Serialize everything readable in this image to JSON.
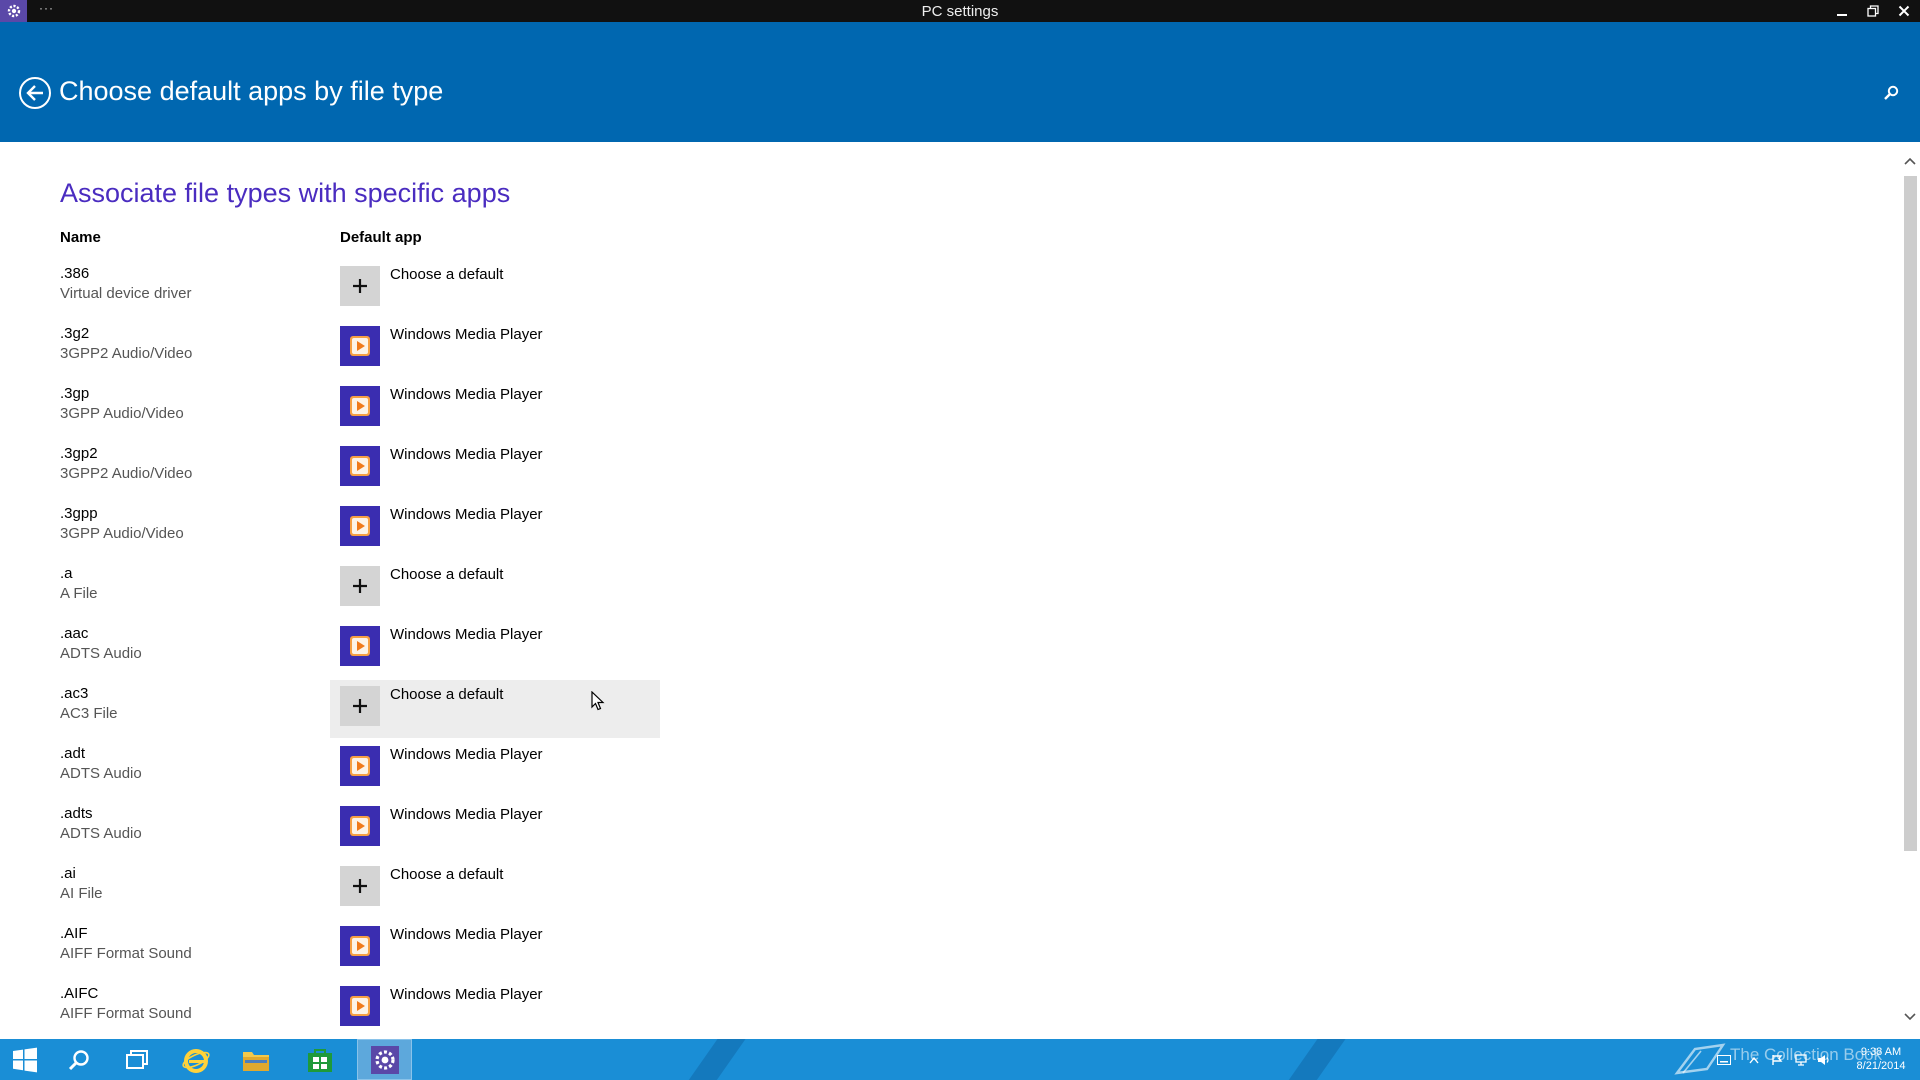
{
  "window": {
    "title": "PC settings",
    "menu_dots": "···"
  },
  "header": {
    "title": "Choose default apps by file type"
  },
  "content": {
    "section_title": "Associate file types with specific apps",
    "col_name": "Name",
    "col_app": "Default app",
    "rows": [
      {
        "ext": ".386",
        "desc": "Virtual device driver",
        "app": "Choose a default",
        "icon": "plus-icon"
      },
      {
        "ext": ".3g2",
        "desc": "3GPP2 Audio/Video",
        "app": "Windows Media Player",
        "icon": "windows-media-player-icon"
      },
      {
        "ext": ".3gp",
        "desc": "3GPP Audio/Video",
        "app": "Windows Media Player",
        "icon": "windows-media-player-icon"
      },
      {
        "ext": ".3gp2",
        "desc": "3GPP2 Audio/Video",
        "app": "Windows Media Player",
        "icon": "windows-media-player-icon"
      },
      {
        "ext": ".3gpp",
        "desc": "3GPP Audio/Video",
        "app": "Windows Media Player",
        "icon": "windows-media-player-icon"
      },
      {
        "ext": ".a",
        "desc": "A File",
        "app": "Choose a default",
        "icon": "plus-icon"
      },
      {
        "ext": ".aac",
        "desc": "ADTS Audio",
        "app": "Windows Media Player",
        "icon": "windows-media-player-icon"
      },
      {
        "ext": ".ac3",
        "desc": "AC3 File",
        "app": "Choose a default",
        "icon": "plus-icon"
      },
      {
        "ext": ".adt",
        "desc": "ADTS Audio",
        "app": "Windows Media Player",
        "icon": "windows-media-player-icon"
      },
      {
        "ext": ".adts",
        "desc": "ADTS Audio",
        "app": "Windows Media Player",
        "icon": "windows-media-player-icon"
      },
      {
        "ext": ".ai",
        "desc": "AI File",
        "app": "Choose a default",
        "icon": "plus-icon"
      },
      {
        "ext": ".AIF",
        "desc": "AIFF Format Sound",
        "app": "Windows Media Player",
        "icon": "windows-media-player-icon"
      },
      {
        "ext": ".AIFC",
        "desc": "AIFF Format Sound",
        "app": "Windows Media Player",
        "icon": "windows-media-player-icon"
      }
    ]
  },
  "taskbar": {
    "watermark": "The Collection Book",
    "time": "9:38 AM",
    "date": "8/21/2014"
  },
  "colors": {
    "header_bg": "#0067b0",
    "accent_title": "#4a2cc0",
    "taskbar_bg": "#1a8ed6",
    "wmp_tile": "#3a2db0"
  }
}
